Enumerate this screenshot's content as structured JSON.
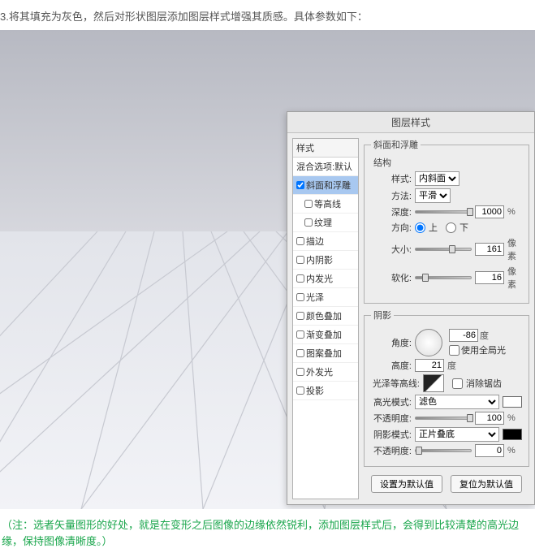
{
  "instruction": "3.将其填充为灰色，然后对形状图层添加图层样式增强其质感。具体参数如下：",
  "dialog": {
    "title": "图层样式",
    "styles_header": "样式",
    "styles": [
      {
        "label": "混合选项:默认",
        "nocheck": true
      },
      {
        "label": "斜面和浮雕",
        "checked": true,
        "selected": true
      },
      {
        "label": "等高线",
        "indent": true
      },
      {
        "label": "纹理",
        "indent": true
      },
      {
        "label": "描边"
      },
      {
        "label": "内阴影"
      },
      {
        "label": "内发光"
      },
      {
        "label": "光泽"
      },
      {
        "label": "颜色叠加"
      },
      {
        "label": "渐变叠加"
      },
      {
        "label": "图案叠加"
      },
      {
        "label": "外发光"
      },
      {
        "label": "投影"
      }
    ],
    "bevel": {
      "legend": "斜面和浮雕",
      "structure_legend": "结构",
      "style_label": "样式:",
      "style_value": "内斜面",
      "method_label": "方法:",
      "method_value": "平滑",
      "depth_label": "深度:",
      "depth_value": "1000",
      "depth_unit": "%",
      "direction_label": "方向:",
      "dir_up": "上",
      "dir_down": "下",
      "size_label": "大小:",
      "size_value": "161",
      "size_unit": "像素",
      "soften_label": "软化:",
      "soften_value": "16",
      "soften_unit": "像素"
    },
    "shading": {
      "legend": "阴影",
      "angle_label": "角度:",
      "angle_value": "-86",
      "angle_unit": "度",
      "global_label": "使用全局光",
      "altitude_label": "高度:",
      "altitude_value": "21",
      "altitude_unit": "度",
      "contour_label": "光泽等高线:",
      "anti_label": "消除锯齿",
      "hi_mode_label": "高光模式:",
      "hi_mode_value": "滤色",
      "hi_opacity_label": "不透明度:",
      "hi_opacity_value": "100",
      "hi_opacity_unit": "%",
      "sh_mode_label": "阴影模式:",
      "sh_mode_value": "正片叠底",
      "sh_opacity_label": "不透明度:",
      "sh_opacity_value": "0",
      "sh_opacity_unit": "%"
    },
    "buttons": {
      "default": "设置为默认值",
      "reset": "复位为默认值"
    }
  },
  "note": "（注：选者矢量图形的好处，就是在变形之后图像的边缘依然锐利，添加图层样式后，会得到比较清楚的高光边缘，保持图像清晰度。）"
}
